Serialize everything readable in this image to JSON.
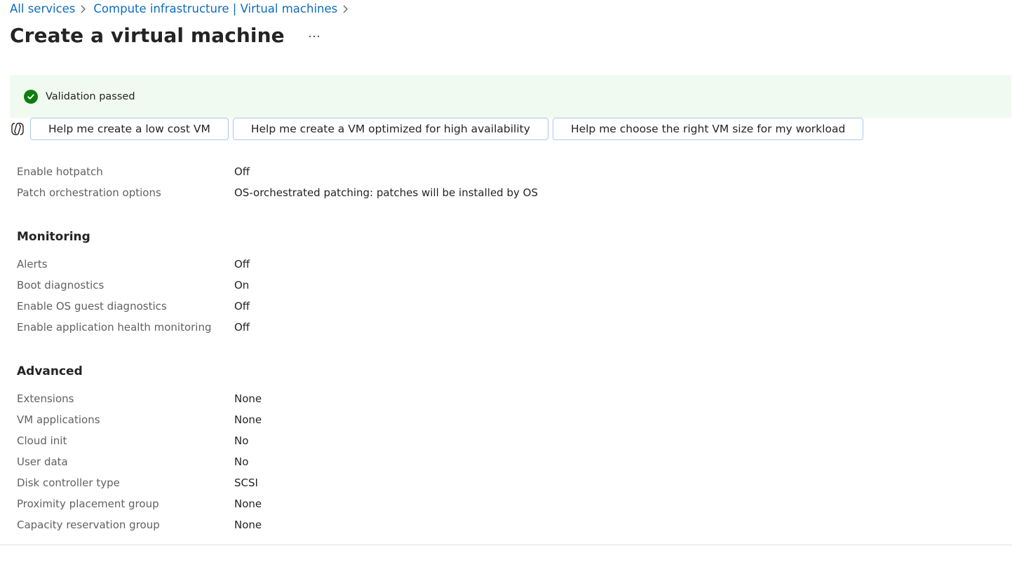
{
  "breadcrumb": {
    "items": [
      "All services",
      "Compute infrastructure | Virtual machines"
    ]
  },
  "header": {
    "title": "Create a virtual machine",
    "more_label": "..."
  },
  "validation": {
    "text": "Validation passed",
    "status_color": "#107c10"
  },
  "copilot": {
    "icon": "copilot-icon",
    "suggestions": [
      "Help me create a low cost VM",
      "Help me create a VM optimized for high availability",
      "Help me choose the right VM size for my workload"
    ]
  },
  "patching": {
    "rows": [
      {
        "label": "Enable hotpatch",
        "value": "Off"
      },
      {
        "label": "Patch orchestration options",
        "value": "OS-orchestrated patching: patches will be installed by OS"
      }
    ]
  },
  "monitoring": {
    "heading": "Monitoring",
    "rows": [
      {
        "label": "Alerts",
        "value": "Off"
      },
      {
        "label": "Boot diagnostics",
        "value": "On"
      },
      {
        "label": "Enable OS guest diagnostics",
        "value": "Off"
      },
      {
        "label": "Enable application health monitoring",
        "value": "Off"
      }
    ]
  },
  "advanced": {
    "heading": "Advanced",
    "rows": [
      {
        "label": "Extensions",
        "value": "None"
      },
      {
        "label": "VM applications",
        "value": "None"
      },
      {
        "label": "Cloud init",
        "value": "No"
      },
      {
        "label": "User data",
        "value": "No"
      },
      {
        "label": "Disk controller type",
        "value": "SCSI"
      },
      {
        "label": "Proximity placement group",
        "value": "None"
      },
      {
        "label": "Capacity reservation group",
        "value": "None"
      }
    ]
  }
}
